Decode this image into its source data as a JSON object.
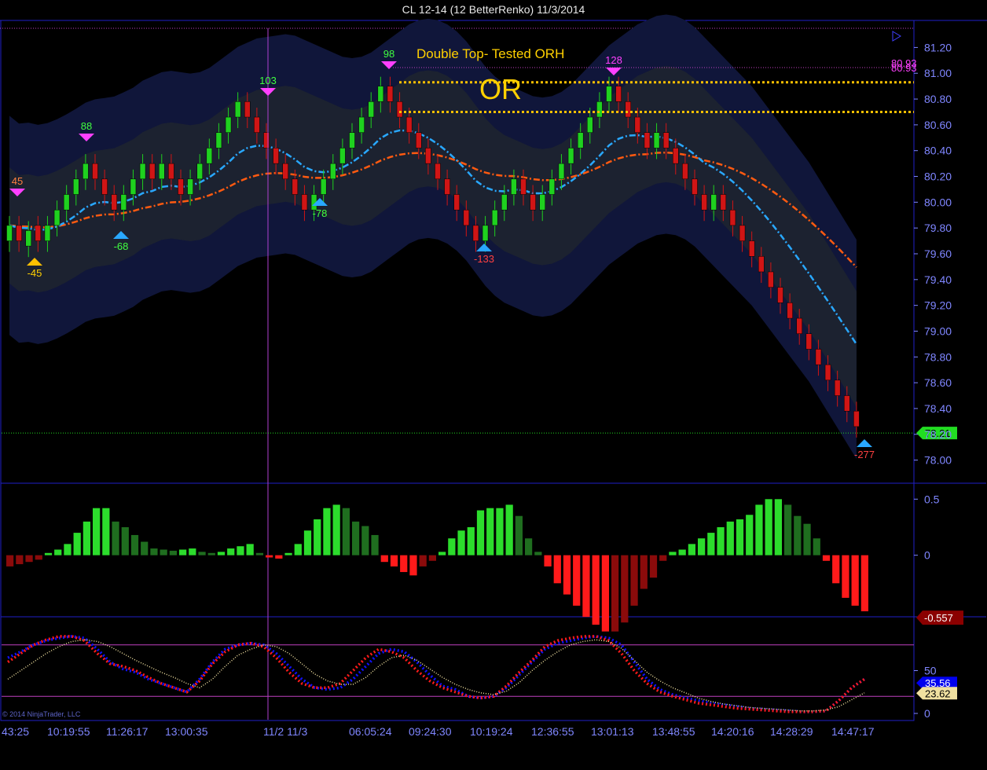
{
  "window": {
    "title": "CL 12-14 (12 BetterRenko)  11/3/2014"
  },
  "copyright": "© 2014 NinjaTrader, LLC",
  "colors": {
    "up_bar": "#1fd11f",
    "down_bar": "#d01515",
    "axis": "#7f86ff",
    "grid_border": "#2020c8",
    "band_inner": "#1c2230",
    "band_outer": "#10163a",
    "ema_fast": "#29a8ff",
    "ema_slow": "#ff5a10",
    "or_lines": "#ffc000",
    "session_line": "#b040d0",
    "last_price": "#22dd22",
    "macd_last": "#8b0000",
    "stoch_blue": "#1010ff",
    "stoch_red": "#ff1a1a",
    "stoch_cream": "#f0e0a0"
  },
  "chart_data": [
    {
      "type": "candlestick",
      "panel": "price",
      "ylim": [
        77.9,
        81.3
      ],
      "y_ticks": [
        "81.20",
        "81.00",
        "80.80",
        "80.60",
        "80.40",
        "80.20",
        "80.00",
        "79.80",
        "79.60",
        "79.40",
        "79.20",
        "79.00",
        "78.80",
        "78.60",
        "78.40",
        "78.20",
        "78.00"
      ],
      "x_ticks": [
        "43:25",
        "10:19:55",
        "11:26:17",
        "13:00:35",
        "11/2 11/3",
        "06:05:24",
        "09:24:30",
        "10:19:24",
        "12:36:55",
        "13:01:13",
        "13:48:55",
        "14:20:16",
        "14:28:29",
        "14:47:17"
      ],
      "closes": [
        79.82,
        79.7,
        79.78,
        79.7,
        79.82,
        79.94,
        80.06,
        80.18,
        80.3,
        80.18,
        80.06,
        79.94,
        80.06,
        80.18,
        80.3,
        80.18,
        80.3,
        80.18,
        80.06,
        80.18,
        80.3,
        80.42,
        80.54,
        80.66,
        80.78,
        80.66,
        80.54,
        80.42,
        80.3,
        80.18,
        80.06,
        79.94,
        80.06,
        80.18,
        80.3,
        80.42,
        80.54,
        80.66,
        80.78,
        80.9,
        80.78,
        80.66,
        80.54,
        80.42,
        80.3,
        80.18,
        80.06,
        79.94,
        79.82,
        79.7,
        79.82,
        79.94,
        80.06,
        80.18,
        80.06,
        79.94,
        80.06,
        80.18,
        80.3,
        80.42,
        80.54,
        80.66,
        80.78,
        80.9,
        80.78,
        80.66,
        80.54,
        80.42,
        80.54,
        80.42,
        80.3,
        80.18,
        80.06,
        79.94,
        80.06,
        79.94,
        79.82,
        79.7,
        79.58,
        79.46,
        79.34,
        79.22,
        79.1,
        78.98,
        78.86,
        78.74,
        78.62,
        78.5,
        78.38,
        78.26
      ],
      "last_price": "78.21",
      "annotations": {
        "title_note": "Double Top- Tested ORH",
        "or_label": "OR",
        "or_high": 80.93,
        "or_low": 80.7,
        "swing_labels": [
          "45",
          "-45",
          "88",
          "-68",
          "103",
          "-78",
          "98",
          "-133",
          "128",
          "-277"
        ],
        "top_right_values": [
          "80.93",
          "80.93"
        ]
      }
    },
    {
      "type": "bar",
      "panel": "macd_histogram",
      "ylim": [
        -0.5,
        0.6
      ],
      "y_ticks": [
        "0.5",
        "0"
      ],
      "last_value": "-0.557",
      "values": [
        -0.1,
        -0.08,
        -0.06,
        -0.04,
        0.02,
        0.05,
        0.1,
        0.2,
        0.3,
        0.42,
        0.42,
        0.3,
        0.25,
        0.18,
        0.12,
        0.06,
        0.05,
        0.04,
        0.05,
        0.06,
        0.03,
        0.02,
        0.03,
        0.06,
        0.08,
        0.1,
        0.02,
        -0.02,
        -0.03,
        0.02,
        0.1,
        0.22,
        0.32,
        0.42,
        0.45,
        0.42,
        0.3,
        0.26,
        0.18,
        -0.06,
        -0.1,
        -0.15,
        -0.18,
        -0.1,
        -0.05,
        0.03,
        0.15,
        0.22,
        0.25,
        0.4,
        0.42,
        0.42,
        0.45,
        0.35,
        0.15,
        0.03,
        -0.1,
        -0.25,
        -0.35,
        -0.45,
        -0.55,
        -0.62,
        -0.68,
        -0.68,
        -0.6,
        -0.45,
        -0.3,
        -0.2,
        -0.05,
        0.03,
        0.05,
        0.1,
        0.15,
        0.2,
        0.25,
        0.3,
        0.32,
        0.36,
        0.45,
        0.5,
        0.5,
        0.45,
        0.35,
        0.28,
        0.15,
        -0.05,
        -0.25,
        -0.38,
        -0.45,
        -0.5
      ]
    },
    {
      "type": "line",
      "panel": "stochastics",
      "ylim": [
        0,
        100
      ],
      "y_ticks": [
        "50",
        "0"
      ],
      "series": [
        {
          "name": "",
          "color": "blue",
          "values": [
            65,
            72,
            80,
            85,
            88,
            90,
            88,
            75,
            60,
            52,
            48,
            40,
            35,
            30,
            25,
            40,
            60,
            75,
            80,
            82,
            80,
            70,
            55,
            40,
            30,
            28,
            30,
            40,
            55,
            70,
            75,
            72,
            60,
            45,
            32,
            28,
            20,
            18,
            20,
            30,
            45,
            60,
            75,
            82,
            85,
            88,
            90,
            88,
            80,
            60,
            40,
            28,
            22,
            18,
            15,
            12,
            10,
            8,
            6,
            5,
            4,
            3,
            2,
            2,
            3,
            15,
            30,
            40
          ]
        },
        {
          "name": "",
          "color": "red",
          "values": [
            60,
            70,
            80,
            86,
            90,
            90,
            85,
            70,
            58,
            55,
            50,
            42,
            35,
            30,
            25,
            38,
            58,
            72,
            80,
            82,
            78,
            65,
            48,
            35,
            30,
            30,
            35,
            50,
            65,
            75,
            72,
            65,
            50,
            38,
            30,
            25,
            20,
            18,
            20,
            32,
            48,
            62,
            78,
            85,
            88,
            90,
            90,
            85,
            70,
            50,
            35,
            25,
            20,
            16,
            12,
            10,
            8,
            6,
            5,
            4,
            3,
            2,
            2,
            2,
            3,
            15,
            30,
            40
          ]
        },
        {
          "name": "",
          "color": "cream",
          "values": [
            40,
            50,
            60,
            70,
            78,
            84,
            86,
            84,
            78,
            70,
            62,
            55,
            48,
            42,
            35,
            30,
            40,
            55,
            68,
            75,
            80,
            78,
            70,
            58,
            46,
            38,
            34,
            34,
            42,
            55,
            65,
            68,
            62,
            52,
            42,
            34,
            28,
            24,
            22,
            26,
            36,
            50,
            62,
            72,
            80,
            84,
            86,
            84,
            76,
            62,
            48,
            38,
            30,
            24,
            18,
            14,
            11,
            9,
            7,
            6,
            5,
            4,
            3,
            3,
            4,
            8,
            16,
            24
          ]
        }
      ],
      "last_values": [
        "35.56",
        "23.62"
      ]
    }
  ]
}
